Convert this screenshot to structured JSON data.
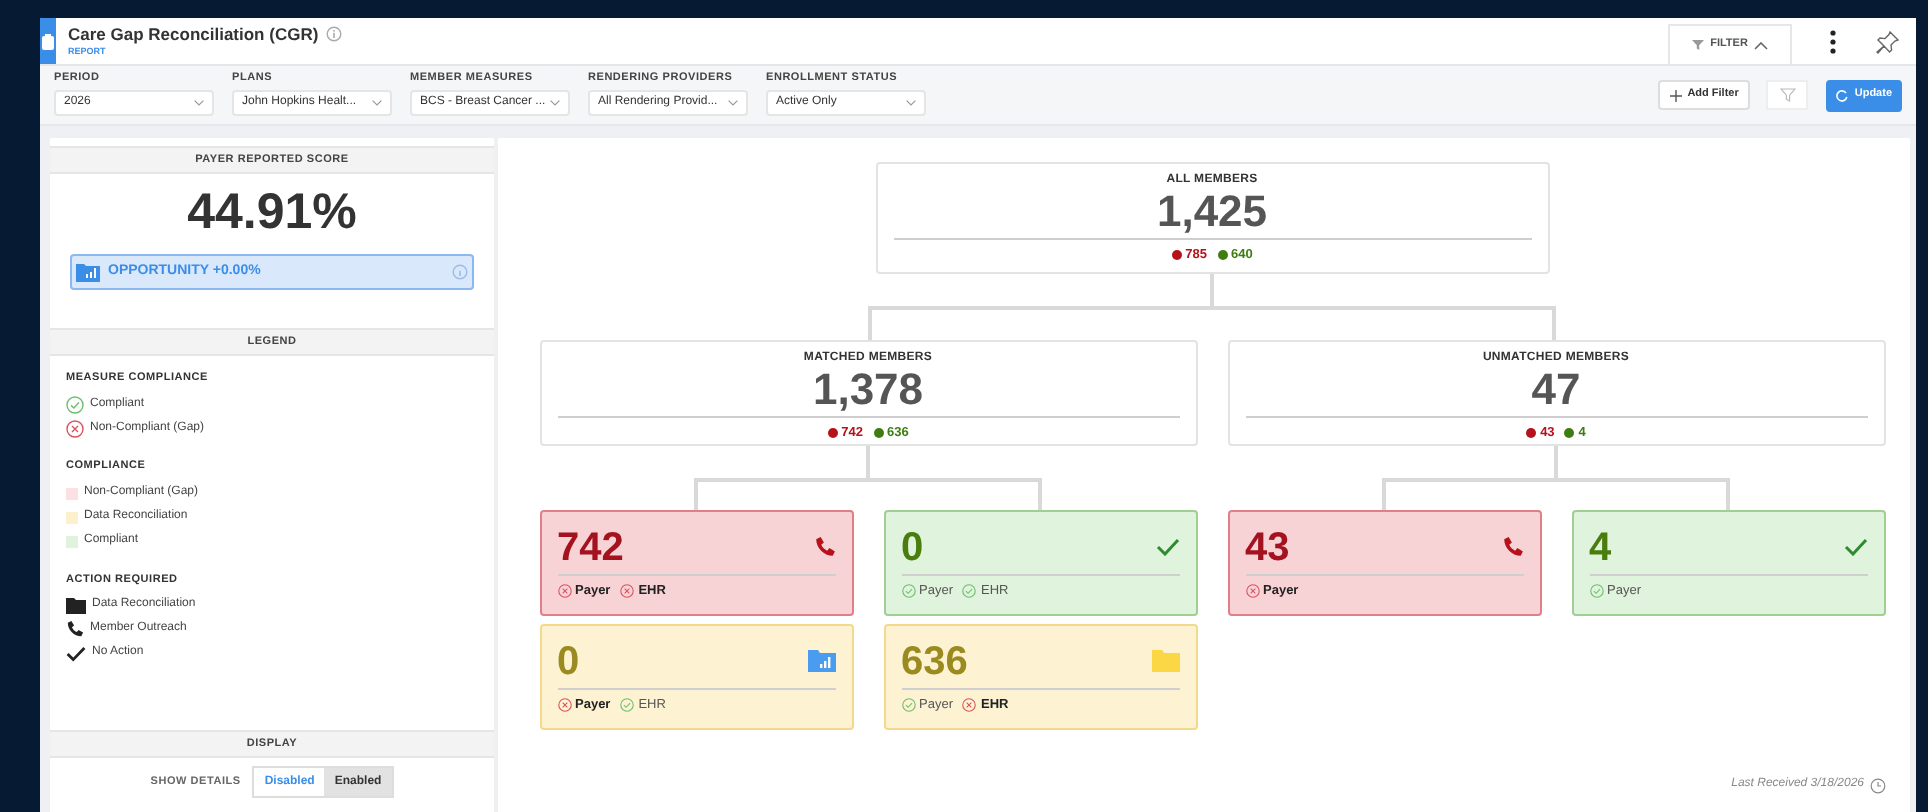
{
  "header": {
    "title": "Care Gap Reconciliation (CGR)",
    "subtitle": "REPORT"
  },
  "filter_tab": {
    "label": "FILTER",
    "expanded": true
  },
  "filters": [
    {
      "label": "PERIOD",
      "value": "2026"
    },
    {
      "label": "PLANS",
      "value": "John Hopkins Healt..."
    },
    {
      "label": "MEMBER MEASURES",
      "value": "BCS - Breast Cancer ..."
    },
    {
      "label": "RENDERING PROVIDERS",
      "value": "All Rendering Provid..."
    },
    {
      "label": "ENROLLMENT STATUS",
      "value": "Active Only"
    }
  ],
  "add_filter": "Add Filter",
  "update": "Update",
  "score_panel": {
    "heading": "PAYER REPORTED SCORE",
    "score": "44.91%",
    "opportunity": "OPPORTUNITY +0.00%"
  },
  "legend": {
    "heading": "LEGEND",
    "sections": [
      {
        "title": "MEASURE COMPLIANCE",
        "items": [
          {
            "kind": "check",
            "label": "Compliant"
          },
          {
            "kind": "cross",
            "label": "Non-Compliant (Gap)"
          }
        ]
      },
      {
        "title": "COMPLIANCE",
        "items": [
          {
            "kind": "swatch",
            "color": "#fbe1e4",
            "label": "Non-Compliant (Gap)"
          },
          {
            "kind": "swatch",
            "color": "#fdf0cc",
            "label": "Data Reconciliation"
          },
          {
            "kind": "swatch",
            "color": "#dff3de",
            "label": "Compliant"
          }
        ]
      },
      {
        "title": "ACTION REQUIRED",
        "items": [
          {
            "kind": "folder",
            "label": "Data Reconciliation"
          },
          {
            "kind": "phone",
            "label": "Member Outreach"
          },
          {
            "kind": "tick",
            "label": "No Action"
          }
        ]
      }
    ]
  },
  "display": {
    "heading": "DISPLAY",
    "label": "SHOW DETAILS",
    "options": [
      {
        "label": "Disabled",
        "selected": true
      },
      {
        "label": "Enabled",
        "selected": false
      }
    ]
  },
  "tree": {
    "root": {
      "label": "ALL MEMBERS",
      "count": "1,425",
      "red": "785",
      "green": "640"
    },
    "branches": [
      {
        "label": "MATCHED MEMBERS",
        "count": "1,378",
        "red": "742",
        "green": "636",
        "tiles": [
          {
            "kind": "gap",
            "count": "742",
            "checks": [
              {
                "label": "Payer",
                "passed": false
              },
              {
                "label": "EHR",
                "passed": false
              }
            ]
          },
          {
            "kind": "compliant",
            "count": "0",
            "checks": [
              {
                "label": "Payer",
                "passed": true
              },
              {
                "label": "EHR",
                "passed": true
              }
            ]
          },
          {
            "kind": "reconcile",
            "count": "0",
            "checks": [
              {
                "label": "Payer",
                "passed": false
              },
              {
                "label": "EHR",
                "passed": true
              }
            ]
          },
          {
            "kind": "reconcile",
            "count": "636",
            "checks": [
              {
                "label": "Payer",
                "passed": true
              },
              {
                "label": "EHR",
                "passed": false
              }
            ]
          }
        ]
      },
      {
        "label": "UNMATCHED MEMBERS",
        "count": "47",
        "red": "43",
        "green": "4",
        "tiles": [
          {
            "kind": "gap",
            "count": "43",
            "checks": [
              {
                "label": "Payer",
                "passed": false
              }
            ]
          },
          {
            "kind": "compliant",
            "count": "4",
            "checks": [
              {
                "label": "Payer",
                "passed": true
              }
            ]
          }
        ]
      }
    ]
  },
  "last_received": "Last Received 3/18/2026"
}
